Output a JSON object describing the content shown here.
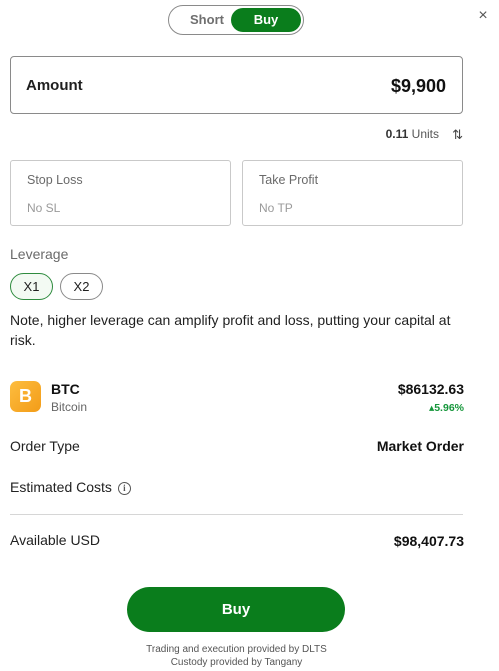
{
  "toggle": {
    "short": "Short",
    "buy": "Buy"
  },
  "close": {
    "icon": "close-icon",
    "glyph": "×"
  },
  "amount": {
    "label": "Amount",
    "value": "$9,900"
  },
  "units": {
    "value": "0.11",
    "suffix": "Units",
    "icon": "swap-vertical-icon"
  },
  "stop_loss": {
    "title": "Stop Loss",
    "value": "No SL"
  },
  "take_profit": {
    "title": "Take Profit",
    "value": "No TP"
  },
  "leverage": {
    "label": "Leverage",
    "options": [
      "X1",
      "X2"
    ],
    "selected": "X1"
  },
  "note": "Note, higher leverage can amplify profit and loss, putting your capital at risk.",
  "asset": {
    "symbol": "BTC",
    "name": "Bitcoin",
    "price": "$86132.63",
    "change": "5.96%",
    "coin_glyph": "B"
  },
  "order_type": {
    "label": "Order Type",
    "value": "Market Order"
  },
  "estimated_costs": {
    "label": "Estimated Costs",
    "icon": "info-icon"
  },
  "available": {
    "label": "Available USD",
    "value": "$98,407.73"
  },
  "buy_button": "Buy",
  "footer": {
    "line1": "Trading and execution provided by DLTS",
    "line2": "Custody provided by Tangany"
  },
  "colors": {
    "accent": "#0a7d1c",
    "positive": "#15963a",
    "coin": "#f7a21b"
  }
}
